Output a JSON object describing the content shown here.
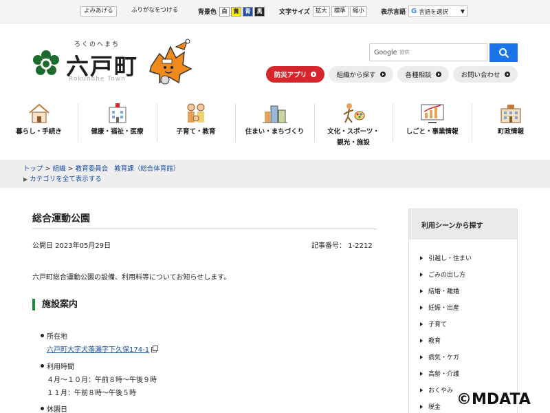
{
  "utility": {
    "read_aloud": "よみあげる",
    "furigana": "ふりがなをつける",
    "bg_color_label": "背景色",
    "bg_white": "白",
    "bg_yellow": "黄",
    "bg_blue": "青",
    "bg_black": "黒",
    "font_size_label": "文字サイズ",
    "font_larger": "拡大",
    "font_standard": "標準",
    "font_smaller": "縮小",
    "language_label": "表示言語",
    "language_select": "言語を選択"
  },
  "header": {
    "kana": "ろくのへまち",
    "town_name": "六戸町",
    "town_roman": "Rokunohe Town",
    "search_brand": "Google",
    "search_sub": "提供",
    "pills": [
      "防災アプリ",
      "組織から探す",
      "各種相談",
      "お問い合わせ"
    ]
  },
  "nav": {
    "items": [
      {
        "label": "暮らし・手続き",
        "icon": "house-icon"
      },
      {
        "label": "健康・福祉・医療",
        "icon": "hospital-icon"
      },
      {
        "label": "子育て・教育",
        "icon": "family-icon"
      },
      {
        "label": "住まい・まちづくり",
        "icon": "city-icon"
      },
      {
        "label": "文化・スポーツ・",
        "label2": "観光・施設",
        "icon": "sports-icon"
      },
      {
        "label": "しごと・事業情報",
        "icon": "chart-icon"
      },
      {
        "label": "町政情報",
        "icon": "townhall-icon"
      }
    ]
  },
  "breadcrumb": {
    "top": "トップ",
    "org": "組織",
    "board": "教育委員会",
    "dept": "教育課（総合体育館）",
    "sep": ">",
    "show_all": "カテゴリを全て表示する"
  },
  "article": {
    "title": "総合運動公園",
    "published": "公開日 2023年05月29日",
    "article_no": "記事番号： 1-2212",
    "intro": "六戸町総合運動公園の設備、利用料等についてお知らせします。",
    "section_heading": "施設案内",
    "location_label": "所在地",
    "location_value": "六戸町大字犬落瀬字下久保174-1",
    "hours_label": "利用時間",
    "hours_1": "４月～１０月：午前８時～午後９時",
    "hours_2": "１１月：午前８時～午後５時",
    "closed_label": "休園日"
  },
  "sidebar": {
    "heading": "利用シーンから探す",
    "items": [
      "引越し・住まい",
      "ごみの出し方",
      "結婚・離婚",
      "妊娠・出産",
      "子育て",
      "教育",
      "病気・ケガ",
      "高齢・介護",
      "おくやみ",
      "税金"
    ]
  },
  "watermark": "©MDATA",
  "colors": {
    "accent_red": "#d7262b",
    "link_blue": "#1a4fa0",
    "heading_green": "#1a8c3b",
    "search_blue": "#1a73e8"
  }
}
